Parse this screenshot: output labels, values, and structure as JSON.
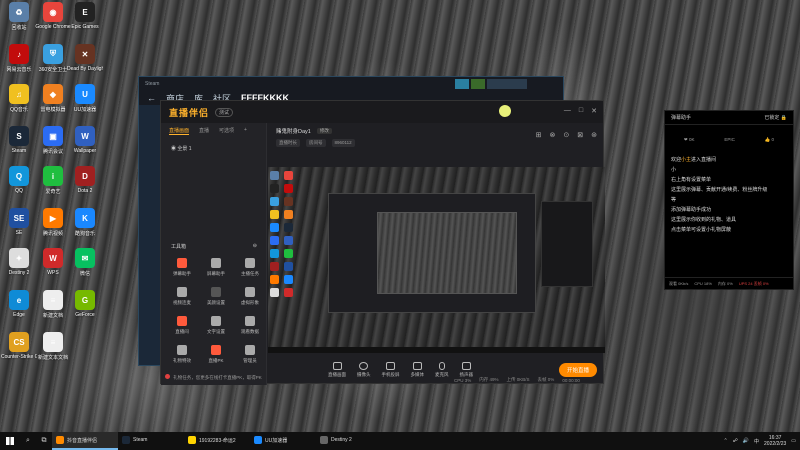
{
  "desktop": {
    "icons": [
      {
        "label": "回收站",
        "color": "#5a7fa8",
        "glyph": "♻"
      },
      {
        "label": "Google Chrome",
        "color": "#e8453c",
        "glyph": "◉"
      },
      {
        "label": "Epic Games",
        "color": "#222",
        "glyph": "E"
      },
      {
        "label": "网易云音乐",
        "color": "#c20c0c",
        "glyph": "♪"
      },
      {
        "label": "360安全卫士",
        "color": "#3aa0e0",
        "glyph": "⛨"
      },
      {
        "label": "Dead By Daylight",
        "color": "#663322",
        "glyph": "✕"
      },
      {
        "label": "QQ音乐",
        "color": "#f0c020",
        "glyph": "♫"
      },
      {
        "label": "雷电模拟器",
        "color": "#f08020",
        "glyph": "◆"
      },
      {
        "label": "UU加速器",
        "color": "#1a8aff",
        "glyph": "U"
      },
      {
        "label": "Steam",
        "color": "#1b2838",
        "glyph": "S"
      },
      {
        "label": "腾讯会议",
        "color": "#2b6cf3",
        "glyph": "▣"
      },
      {
        "label": "Wallpaper",
        "color": "#3060c0",
        "glyph": "W"
      },
      {
        "label": "QQ",
        "color": "#1296db",
        "glyph": "Q"
      },
      {
        "label": "爱奇艺",
        "color": "#1fbe3f",
        "glyph": "i"
      },
      {
        "label": "Dota 2",
        "color": "#a02020",
        "glyph": "D"
      },
      {
        "label": "SE",
        "color": "#2050a0",
        "glyph": "SE"
      },
      {
        "label": "腾讯视频",
        "color": "#ff7a00",
        "glyph": "▶"
      },
      {
        "label": "酷狗音乐",
        "color": "#1a88ff",
        "glyph": "K"
      },
      {
        "label": "Destiny 2",
        "color": "#ddd",
        "glyph": "✦"
      },
      {
        "label": "WPS",
        "color": "#d02a2a",
        "glyph": "W"
      },
      {
        "label": "微信",
        "color": "#07c160",
        "glyph": "✉"
      },
      {
        "label": "Edge",
        "color": "#0f8bd6",
        "glyph": "e"
      },
      {
        "label": "新建文档",
        "color": "#eee",
        "glyph": "≡"
      },
      {
        "label": "GeForce",
        "color": "#76b900",
        "glyph": "G"
      },
      {
        "label": "Counter-Strike Global Off",
        "color": "#e0a020",
        "glyph": "CS"
      },
      {
        "label": "新建文本文档",
        "color": "#eee",
        "glyph": "≡"
      }
    ]
  },
  "steam_window": {
    "title": "Steam",
    "nav": [
      "商店",
      "库",
      "社区",
      "FFFFKKKK"
    ]
  },
  "app": {
    "logo": "直播伴侣",
    "version": "测试",
    "window_controls": [
      "—",
      "□",
      "✕"
    ],
    "left_tabs": [
      "直播画面",
      "直播",
      "可选项"
    ],
    "scene": "全景 1",
    "toolbox_title": "工具箱",
    "tools": [
      {
        "label": "弹幕助手",
        "color": "#ff5a3c"
      },
      {
        "label": "屏幕助手",
        "color": "#aaaaaa"
      },
      {
        "label": "主播任务",
        "color": "#aaaaaa"
      },
      {
        "label": "视频连麦",
        "color": "#aaaaaa"
      },
      {
        "label": "美颜设置",
        "color": "#555555"
      },
      {
        "label": "虚拟形象",
        "color": "#aaaaaa"
      },
      {
        "label": "直播间",
        "color": "#ff5a3c"
      },
      {
        "label": "文字设置",
        "color": "#aaaaaa"
      },
      {
        "label": "观看数据",
        "color": "#aaaaaa"
      },
      {
        "label": "礼物特效",
        "color": "#aaaaaa"
      },
      {
        "label": "直播PK",
        "color": "#ff5a3c"
      },
      {
        "label": "管理员",
        "color": "#aaaaaa"
      }
    ],
    "notice": "礼物任务，您更多在线打卡直播PK，取得PK",
    "title": "赌鬼附身Day1",
    "title_edit": "修改",
    "meta": [
      "直播时长",
      "房间号",
      "8960112"
    ],
    "header_icons": [
      "⊞",
      "⊗",
      "⊙",
      "⊠",
      "⊛"
    ],
    "controls": [
      "直播画面",
      "摄像头",
      "手机投屏",
      "多媒体",
      "麦克风",
      "扬声器"
    ],
    "go_live": "开始直播",
    "status": [
      "CPU 3%",
      "内存 49%",
      "上传 0KB/S",
      "丢帧 0%"
    ],
    "timer": "00:00:00"
  },
  "chat": {
    "title": "弹幕助手",
    "status": "已锁定",
    "stats": [
      "❤ 0K",
      "EPIC",
      "👍 0"
    ],
    "messages": [
      {
        "prefix": "欢迎",
        "user": "小主",
        "text": "进入直播间"
      },
      {
        "prefix": "",
        "user": "",
        "text": "小"
      },
      {
        "prefix": "",
        "user": "",
        "text": "右上角有设置菜单"
      },
      {
        "prefix": "",
        "user": "",
        "text": "这里展示弹幕、贡献开通/续费、粉丝牌升级"
      },
      {
        "prefix": "",
        "user": "",
        "text": "等"
      },
      {
        "prefix": "",
        "user": "",
        "text": "添加弹幕助手成功"
      },
      {
        "prefix": "",
        "user": "",
        "text": "这里展示你收到的礼物、道具"
      },
      {
        "prefix": "",
        "user": "",
        "text": "点击菜单可设置小礼物屏蔽"
      }
    ],
    "footer": [
      "观看 0Kb/s",
      "CPU 18%",
      "内存 0%",
      "UPS 24 丢帧 0%"
    ]
  },
  "taskbar": {
    "apps": [
      {
        "label": "抖音直播伴侣",
        "color": "#ff8a00",
        "active": true
      },
      {
        "label": "Steam",
        "color": "#1b2838",
        "active": false
      },
      {
        "label": "19192283-命运2",
        "color": "#ffd400",
        "active": false
      },
      {
        "label": "UU加速器",
        "color": "#1a8aff",
        "active": false
      },
      {
        "label": "Destiny 2",
        "color": "#666",
        "active": false
      }
    ],
    "time": "16:37",
    "date": "2022/2/23",
    "lang": "中"
  }
}
